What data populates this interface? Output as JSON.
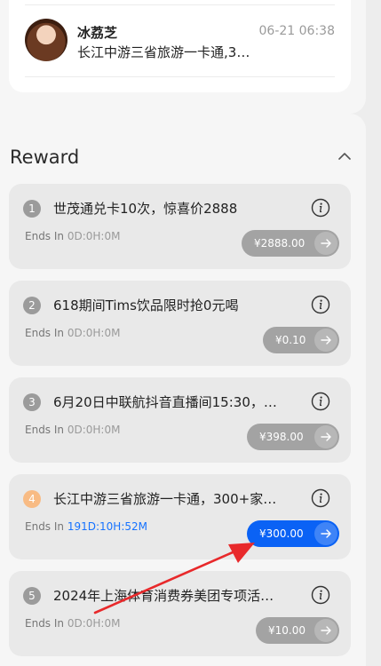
{
  "message": {
    "name": "冰荔芝",
    "time": "06-21 06:38",
    "preview": "长江中游三省旅游一卡通,3…"
  },
  "reward": {
    "header": "Reward",
    "ends_prefix": "Ends In",
    "items": [
      {
        "rank": "1",
        "title": "世茂通兑卡10次，惊喜价2888",
        "countdown": "0D:0H:0M",
        "price": "¥2888.00",
        "active": false
      },
      {
        "rank": "2",
        "title": "618期间Tims饮品限时抢0元喝",
        "countdown": "0D:0H:0M",
        "price": "¥0.10",
        "active": false
      },
      {
        "rank": "3",
        "title": "6月20日中联航抖音直播间15:30，…",
        "countdown": "0D:0H:0M",
        "price": "¥398.00",
        "active": false
      },
      {
        "rank": "4",
        "title": "长江中游三省旅游一卡通，300+家…",
        "countdown": "191D:10H:52M",
        "price": "¥300.00",
        "active": true
      },
      {
        "rank": "5",
        "title": "2024年上海体育消费券美团专项活…",
        "countdown": "0D:0H:0M",
        "price": "¥10.00",
        "active": false
      }
    ]
  },
  "colors": {
    "accent": "#0a62f5",
    "active_countdown": "#1773ff",
    "active_rank": "#f8bb84",
    "annotation_arrow": "#e8292b"
  }
}
